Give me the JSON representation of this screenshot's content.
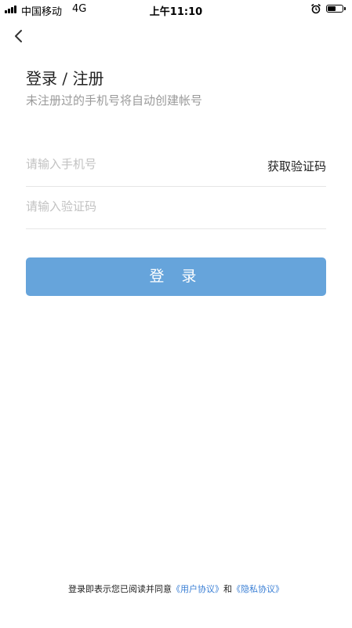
{
  "statusbar": {
    "carrier": "中国移动",
    "network": "4G",
    "time": "上午11:10",
    "battery_level": 0.6
  },
  "header": {
    "back_icon": "chevron-left-icon"
  },
  "page": {
    "title": "登录 / 注册",
    "subtitle": "未注册过的手机号将自动创建帐号"
  },
  "form": {
    "phone_placeholder": "请输入手机号",
    "phone_value": "",
    "get_code_label": "获取验证码",
    "code_placeholder": "请输入验证码",
    "code_value": "",
    "login_label": "登 录"
  },
  "agreement": {
    "prefix": "登录即表示您已阅读并同意",
    "user_agreement": "《用户协议》",
    "conjunction": "和",
    "privacy_agreement": "《隐私协议》"
  },
  "colors": {
    "primary_button": "#66a4db",
    "link": "#3a7fd5",
    "placeholder": "#c2c2c2",
    "subtitle": "#9a9a9a"
  }
}
